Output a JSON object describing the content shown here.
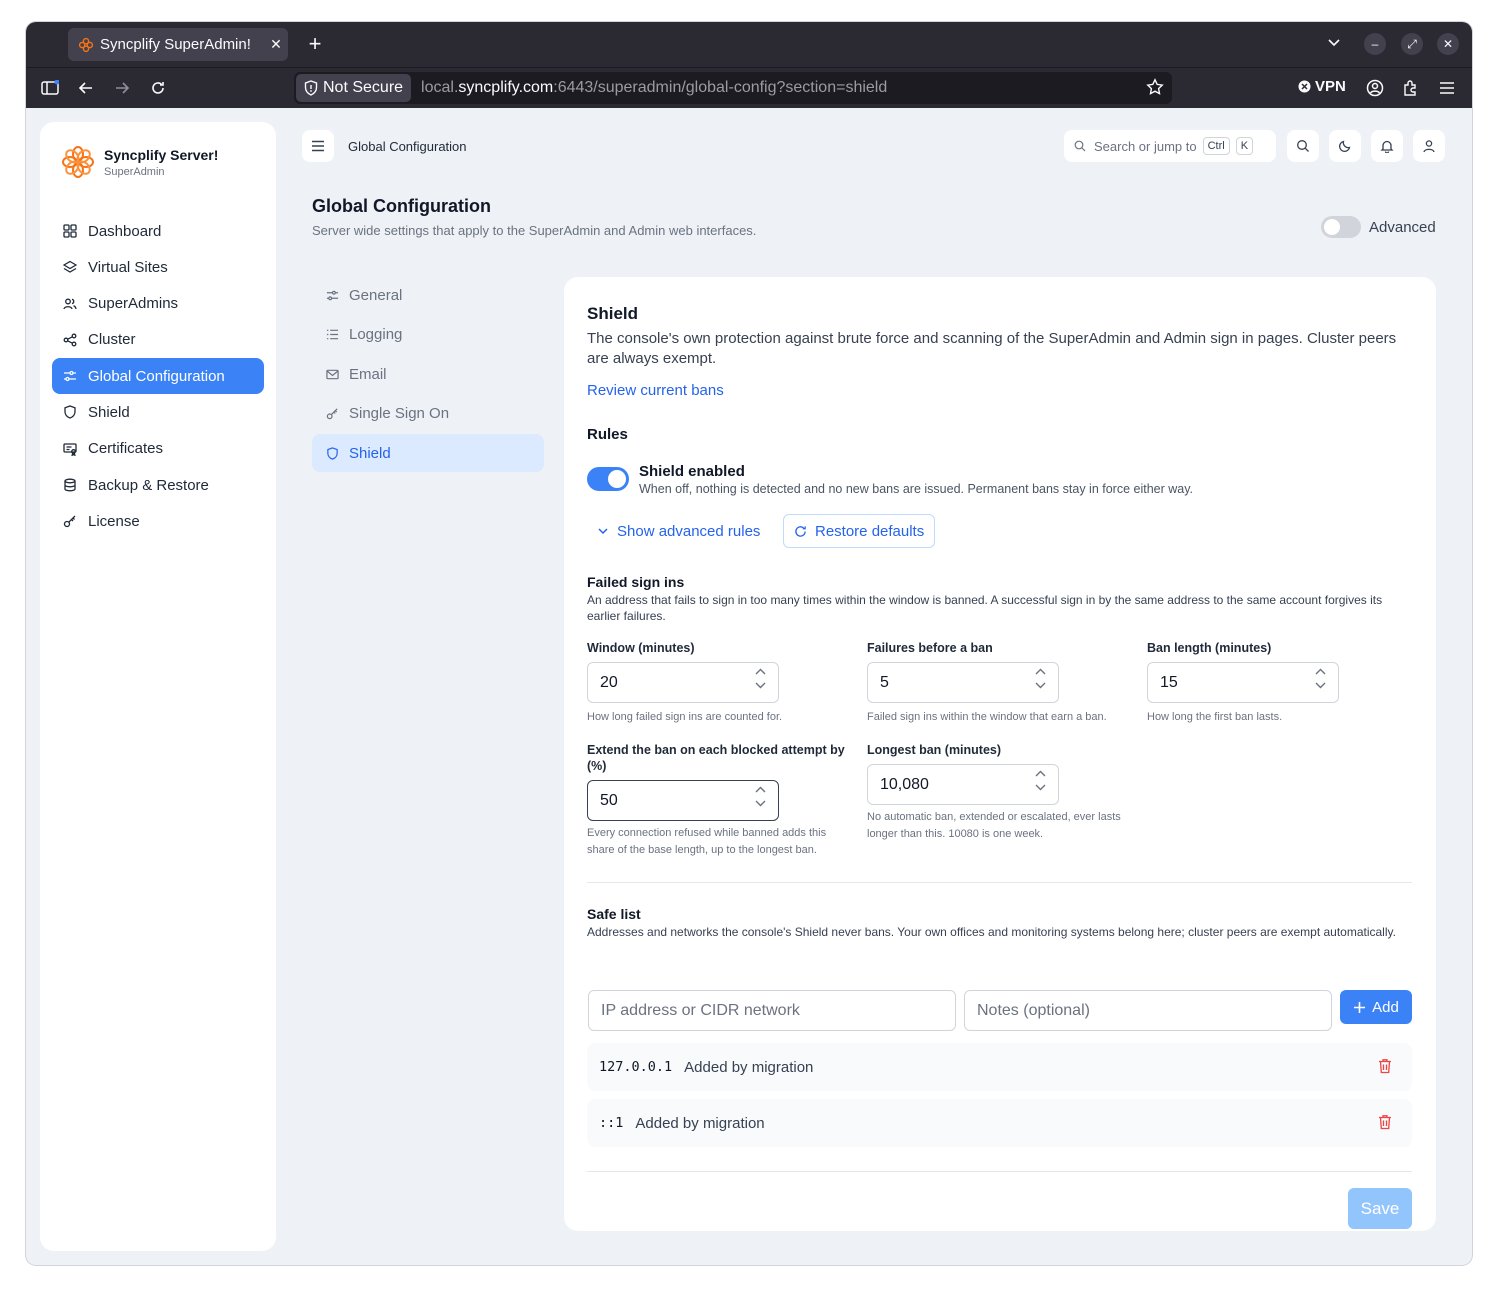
{
  "browser": {
    "tab_title": "Syncplify SuperAdmin!",
    "security_label": "Not Secure",
    "url_prefix": "local.",
    "url_host": "syncplify.com",
    "url_rest": ":6443/superadmin/global-config?section=shield",
    "vpn_label": "VPN"
  },
  "sidebar": {
    "brand_name": "Syncplify Server!",
    "brand_sub": "SuperAdmin",
    "items": [
      {
        "label": "Dashboard",
        "icon": "grid-icon"
      },
      {
        "label": "Virtual Sites",
        "icon": "layers-icon"
      },
      {
        "label": "SuperAdmins",
        "icon": "users-icon"
      },
      {
        "label": "Cluster",
        "icon": "share-icon"
      },
      {
        "label": "Global Configuration",
        "icon": "sliders-icon",
        "active": true
      },
      {
        "label": "Shield",
        "icon": "shield-icon"
      },
      {
        "label": "Certificates",
        "icon": "certificate-icon"
      },
      {
        "label": "Backup & Restore",
        "icon": "database-icon"
      },
      {
        "label": "License",
        "icon": "key-icon"
      }
    ]
  },
  "topbar": {
    "title": "Global Configuration",
    "search_placeholder": "Search or jump to",
    "kbd_ctrl": "Ctrl",
    "kbd_k": "K"
  },
  "page": {
    "title": "Global Configuration",
    "subtitle": "Server wide settings that apply to the SuperAdmin and Admin web interfaces.",
    "advanced_label": "Advanced",
    "advanced_on": false
  },
  "subnav": {
    "items": [
      {
        "label": "General",
        "icon": "sliders-icon"
      },
      {
        "label": "Logging",
        "icon": "list-icon"
      },
      {
        "label": "Email",
        "icon": "mail-icon"
      },
      {
        "label": "Single Sign On",
        "icon": "key-icon"
      },
      {
        "label": "Shield",
        "icon": "shield-icon",
        "active": true
      }
    ]
  },
  "shield": {
    "title": "Shield",
    "description": "The console's own protection against brute force and scanning of the SuperAdmin and Admin sign in pages. Cluster peers are always exempt.",
    "review_link": "Review current bans",
    "rules_heading": "Rules",
    "enabled_title": "Shield enabled",
    "enabled_desc": "When off, nothing is detected and no new bans are issued. Permanent bans stay in force either way.",
    "enabled": true,
    "show_advanced_label": "Show advanced rules",
    "restore_defaults_label": "Restore defaults",
    "failed": {
      "heading": "Failed sign ins",
      "description": "An address that fails to sign in too many times within the window is banned. A successful sign in by the same address to the same account forgives its earlier failures.",
      "window_label": "Window (minutes)",
      "window_value": "20",
      "window_help": "How long failed sign ins are counted for.",
      "failures_label": "Failures before a ban",
      "failures_value": "5",
      "failures_help": "Failed sign ins within the window that earn a ban.",
      "ban_label": "Ban length (minutes)",
      "ban_value": "15",
      "ban_help": "How long the first ban lasts.",
      "extend_label": "Extend the ban on each blocked attempt by (%)",
      "extend_value": "50",
      "extend_help": "Every connection refused while banned adds this share of the base length, up to the longest ban.",
      "longest_label": "Longest ban (minutes)",
      "longest_value": "10,080",
      "longest_help": "No automatic ban, extended or escalated, ever lasts longer than this. 10080 is one week."
    },
    "safe": {
      "heading": "Safe list",
      "description": "Addresses and networks the console's Shield never bans. Your own offices and monitoring systems belong here; cluster peers are exempt automatically.",
      "ip_placeholder": "IP address or CIDR network",
      "notes_placeholder": "Notes (optional)",
      "add_label": "Add",
      "entries": [
        {
          "address": "127.0.0.1",
          "note": "Added by migration"
        },
        {
          "address": "::1",
          "note": "Added by migration"
        }
      ]
    },
    "save_label": "Save"
  },
  "colors": {
    "accent": "#3b82f6",
    "accent_text": "#2563eb",
    "danger": "#ef4444",
    "brand_orange": "#f97316"
  }
}
